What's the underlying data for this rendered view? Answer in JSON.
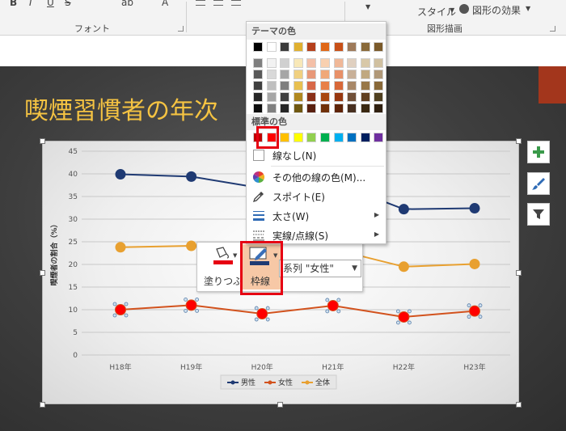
{
  "ribbon": {
    "font_group_label": "フォント",
    "shape_group_label": "図形描画",
    "quick_style_label": "スタイル",
    "shape_effects_label": "図形の効果",
    "font_buttons": [
      "B",
      "I",
      "U",
      "S",
      "ab",
      "A"
    ]
  },
  "slide": {
    "title": "喫煙習慣者の年次"
  },
  "mini_toolbar": {
    "fill_label": "塗りつぶし",
    "outline_label": "枠線",
    "series_selector": "系列 \"女性\""
  },
  "color_menu": {
    "theme_header": "テーマの色",
    "standard_header": "標準の色",
    "theme_top_row": [
      "#000000",
      "#ffffff",
      "#3c3c3c",
      "#e0b030",
      "#b5401c",
      "#e06818",
      "#c85018",
      "#9e7a5a",
      "#8a6a3a",
      "#7a5a2a"
    ],
    "theme_shade_rows": [
      [
        "#7f7f7f",
        "#f2f2f2",
        "#d0d0d0",
        "#f8e8b8",
        "#f4c0a8",
        "#f8d0b0",
        "#f0b898",
        "#e0d0c0",
        "#d8c8a8",
        "#d0c0a0"
      ],
      [
        "#595959",
        "#d9d9d9",
        "#a6a6a6",
        "#f0d080",
        "#e89878",
        "#f0a878",
        "#e89068",
        "#c8b098",
        "#c0a880",
        "#b09878"
      ],
      [
        "#404040",
        "#bfbfbf",
        "#7f7f7f",
        "#e8c050",
        "#d86848",
        "#e88048",
        "#d86838",
        "#a88868",
        "#987848",
        "#886838"
      ],
      [
        "#262626",
        "#a6a6a6",
        "#404040",
        "#b08820",
        "#8a3018",
        "#a84810",
        "#983810",
        "#705038",
        "#604020",
        "#504020"
      ],
      [
        "#0d0d0d",
        "#808080",
        "#262626",
        "#705810",
        "#5a2010",
        "#703008",
        "#602408",
        "#483020",
        "#3a2810",
        "#302010"
      ]
    ],
    "standard_colors": [
      "#c00000",
      "#ff0000",
      "#ffc000",
      "#ffff00",
      "#92d050",
      "#00b050",
      "#00b0f0",
      "#0070c0",
      "#002060",
      "#7030a0"
    ],
    "items": {
      "no_line": "線なし(N)",
      "more_colors": "その他の線の色(M)...",
      "eyedropper": "スポイト(E)",
      "weight": "太さ(W)",
      "dashes": "実線/点線(S)"
    }
  },
  "chart_data": {
    "type": "line",
    "categories": [
      "H18年",
      "H19年",
      "H20年",
      "H21年",
      "H22年",
      "H23年"
    ],
    "ylim": [
      0,
      45
    ],
    "yticks": [
      "0",
      "5",
      "10",
      "15",
      "20",
      "25",
      "30",
      "35",
      "40",
      "45"
    ],
    "ylabel": "喫煙者の割合（%）",
    "xlabel": "",
    "grid": true,
    "legend_position": "bottom",
    "series": [
      {
        "name": "男性",
        "color": "#1f3a73",
        "values": [
          39.9,
          39.4,
          36.8,
          38.2,
          32.2,
          32.4
        ]
      },
      {
        "name": "女性",
        "color": "#d2521d",
        "values": [
          10.0,
          11.0,
          9.1,
          10.9,
          8.4,
          9.7
        ]
      },
      {
        "name": "全体",
        "color": "#e8a030",
        "values": [
          23.8,
          24.1,
          21.8,
          23.4,
          19.5,
          20.1
        ]
      }
    ]
  }
}
